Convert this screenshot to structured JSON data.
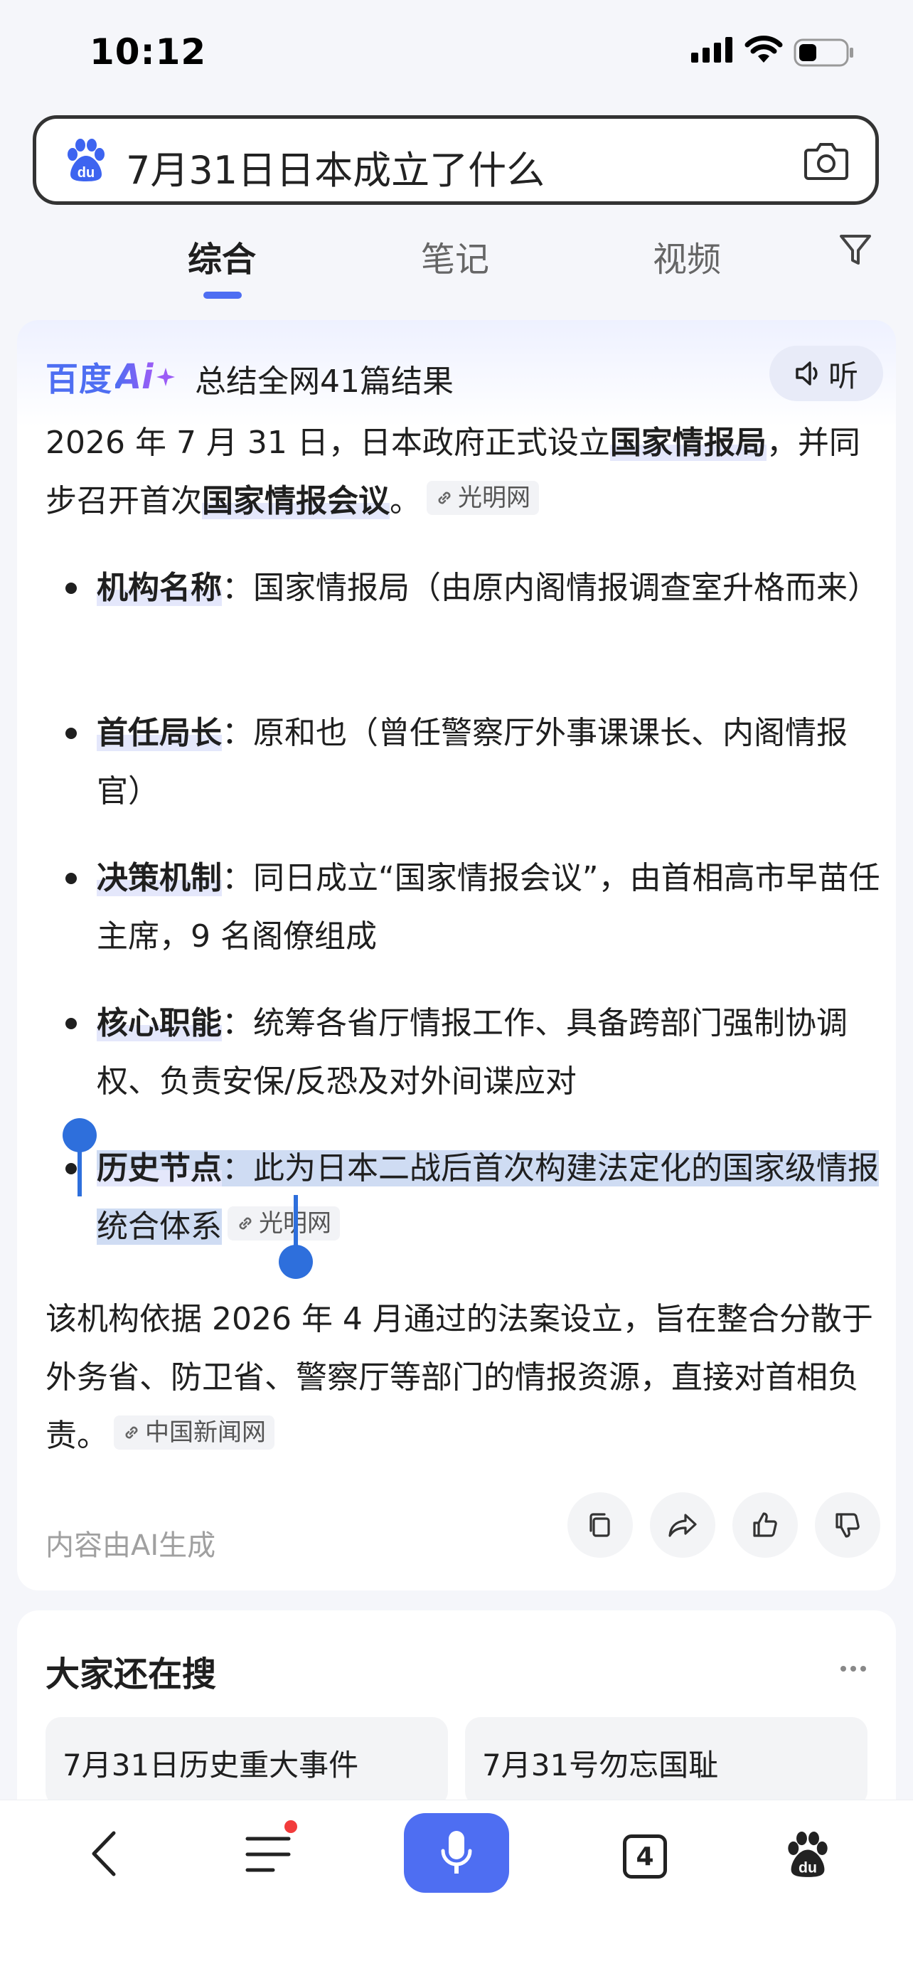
{
  "status": {
    "time": "10:12"
  },
  "search": {
    "query": "7月31日日本成立了什么"
  },
  "tabs": [
    {
      "label": "综合",
      "active": true
    },
    {
      "label": "笔记",
      "active": false
    },
    {
      "label": "视频",
      "active": false
    }
  ],
  "ai": {
    "brand_text": "百度",
    "brand_ai": "Ai",
    "summary": "总结全网41篇结果",
    "listen": "听",
    "intro": {
      "t1": "2026 年 7 月 31 日，日本政府正式设立",
      "h1": "国家情报局",
      "t2": "，并同步召开首次",
      "h2": "国家情报会议",
      "t3": "。",
      "source": "光明网"
    },
    "bullets": [
      {
        "label": "机构名称",
        "text": "：国家情报局（由原内阁情报调查室升格而来）"
      },
      {
        "label": "首任局长",
        "text": "：原和也（曾任警察厅外事课课长、内阁情报官）"
      },
      {
        "label": "决策机制",
        "text": "：同日成立“国家情报会议”，由首相高市早苗任主席，9 名阁僚组成"
      },
      {
        "label": "核心职能",
        "text": "：统筹各省厅情报工作、具备跨部门强制协调权、负责安保/反恐及对外间谍应对"
      },
      {
        "label": "历史节点",
        "text": "：此为日本二战后首次构建法定化的国家级情报统合体系",
        "source": "光明网"
      }
    ],
    "closing": {
      "text": "该机构依据 2026 年 4 月通过的法案设立，旨在整合分散于外务省、防卫省、警察厅等部门的情报资源，直接对首相负责。",
      "source": "中国新闻网"
    },
    "note": "内容由AI生成"
  },
  "also": {
    "title": "大家还在搜",
    "items": [
      "7月31日历史重大事件",
      "7月31号勿忘国耻"
    ]
  },
  "bottom": {
    "tabs_count": "4"
  },
  "colors": {
    "accent": "#4e6ef2",
    "selection": "#cfdcf3",
    "badge": "#f23b3b"
  }
}
